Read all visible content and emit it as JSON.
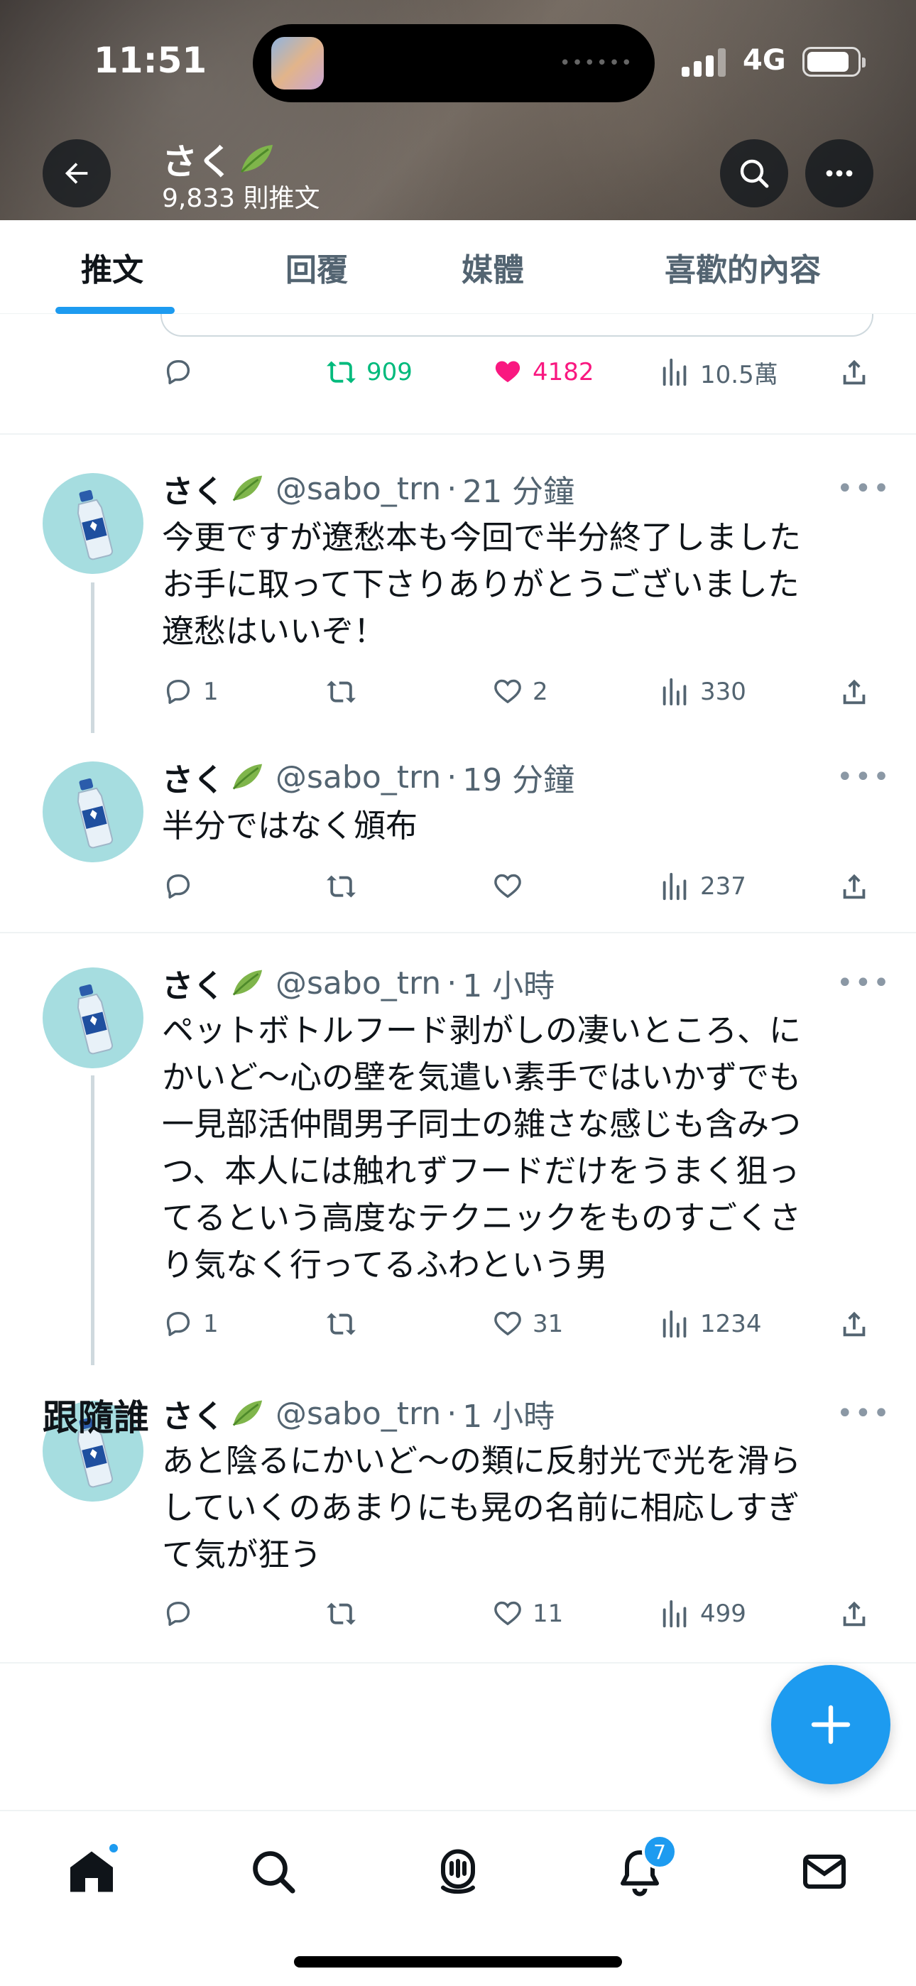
{
  "status_bar": {
    "time": "11:51",
    "network": "4G",
    "battery_level": 0.85
  },
  "profile": {
    "name": "さく",
    "post_count": "9,833 則推文"
  },
  "tabs": [
    {
      "label": "推文",
      "active": true
    },
    {
      "label": "回覆",
      "active": false
    },
    {
      "label": "媒體",
      "active": false
    },
    {
      "label": "喜歡的內容",
      "active": false
    }
  ],
  "pinned_actions": {
    "retweets": "909",
    "likes": "4182",
    "views": "10.5萬"
  },
  "tweets": [
    {
      "name": "さく",
      "handle": "@sabo_trn",
      "time": "21 分鐘",
      "text": "今更ですが遼愁本も今回で半分終了しました\nお手に取って下さりありがとうございました\n遼愁はいいぞ！",
      "replies": "1",
      "retweets": "",
      "likes": "2",
      "views": "330"
    },
    {
      "name": "さく",
      "handle": "@sabo_trn",
      "time": "19 分鐘",
      "text": "半分ではなく頒布",
      "replies": "",
      "retweets": "",
      "likes": "",
      "views": "237"
    },
    {
      "name": "さく",
      "handle": "@sabo_trn",
      "time": "1 小時",
      "text": "ペットボトルフード剥がしの凄いところ、に\nかいど～心の壁を気遣い素手ではいかずでも\n一見部活仲間男子同士の雑さな感じも含みつ\nつ、本人には触れずフードだけをうまく狙っ\nてるという高度なテクニックをものすごくさ\nり気なく行ってるふわという男",
      "replies": "1",
      "retweets": "",
      "likes": "31",
      "views": "1234"
    },
    {
      "name": "さく",
      "handle": "@sabo_trn",
      "time": "1 小時",
      "text": "あと陰るにかいど～の類に反射光で光を滑ら\nしていくのあまりにも晃の名前に相応しすぎ\nて気が狂う",
      "replies": "",
      "retweets": "",
      "likes": "11",
      "views": "499"
    }
  ],
  "who_to_follow": {
    "title": "跟隨誰"
  },
  "bottom_nav": {
    "notification_count": "7"
  },
  "icons": {
    "back": "back-arrow-icon",
    "search": "search-icon",
    "more": "more-icon",
    "reply": "reply-icon",
    "retweet": "retweet-icon",
    "like": "heart-icon",
    "views": "views-icon",
    "share": "share-icon",
    "compose": "plus-icon",
    "home": "home-icon",
    "explore": "search-icon",
    "spaces": "spaces-icon",
    "notifications": "bell-icon",
    "messages": "mail-icon",
    "leaf": "leaf-icon"
  },
  "colors": {
    "accent": "#1d9bf0",
    "like": "#f91880",
    "retweet": "#00ba7c",
    "secondary_text": "#536471"
  }
}
